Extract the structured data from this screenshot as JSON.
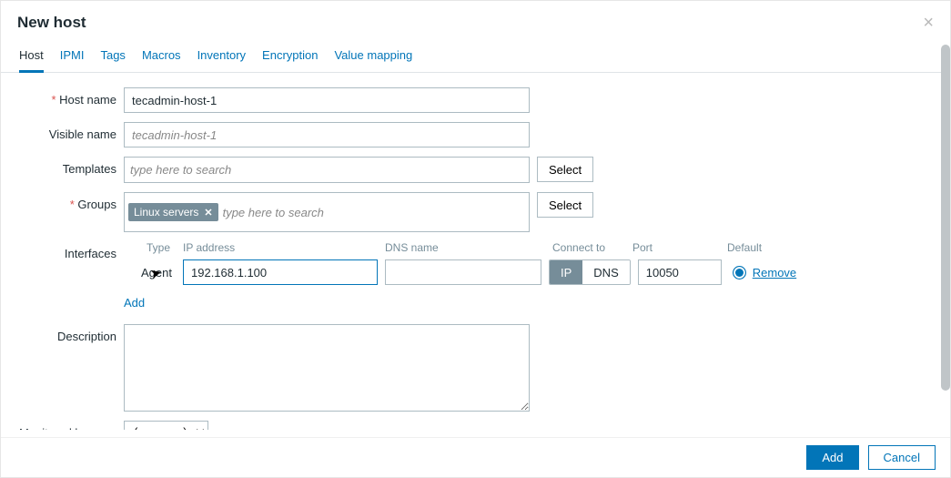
{
  "dialog": {
    "title": "New host",
    "close_glyph": "×"
  },
  "tabs": [
    {
      "id": "host",
      "label": "Host",
      "active": true
    },
    {
      "id": "ipmi",
      "label": "IPMI"
    },
    {
      "id": "tags",
      "label": "Tags"
    },
    {
      "id": "macros",
      "label": "Macros"
    },
    {
      "id": "inventory",
      "label": "Inventory"
    },
    {
      "id": "encryption",
      "label": "Encryption"
    },
    {
      "id": "value-mapping",
      "label": "Value mapping"
    }
  ],
  "labels": {
    "host_name": "Host name",
    "visible_name": "Visible name",
    "templates": "Templates",
    "groups": "Groups",
    "interfaces": "Interfaces",
    "description": "Description",
    "monitored_by_proxy": "Monitored by proxy"
  },
  "fields": {
    "host_name": "tecadmin-host-1",
    "visible_name_placeholder": "tecadmin-host-1",
    "templates_placeholder": "type here to search",
    "groups_placeholder": "type here to search",
    "group_tags": [
      {
        "label": "Linux servers"
      }
    ],
    "proxy_value": "(no proxy)"
  },
  "interface": {
    "headers": {
      "type": "Type",
      "ip": "IP address",
      "dns": "DNS name",
      "connect": "Connect to",
      "port": "Port",
      "default": "Default"
    },
    "rows": [
      {
        "type_label": "Agent",
        "ip": "192.168.1.100",
        "dns": "",
        "connect": "IP",
        "port": "10050",
        "default": true
      }
    ],
    "connect_options": {
      "ip": "IP",
      "dns": "DNS"
    },
    "remove_label": "Remove",
    "add_label": "Add"
  },
  "buttons": {
    "select": "Select",
    "add": "Add",
    "cancel": "Cancel"
  }
}
